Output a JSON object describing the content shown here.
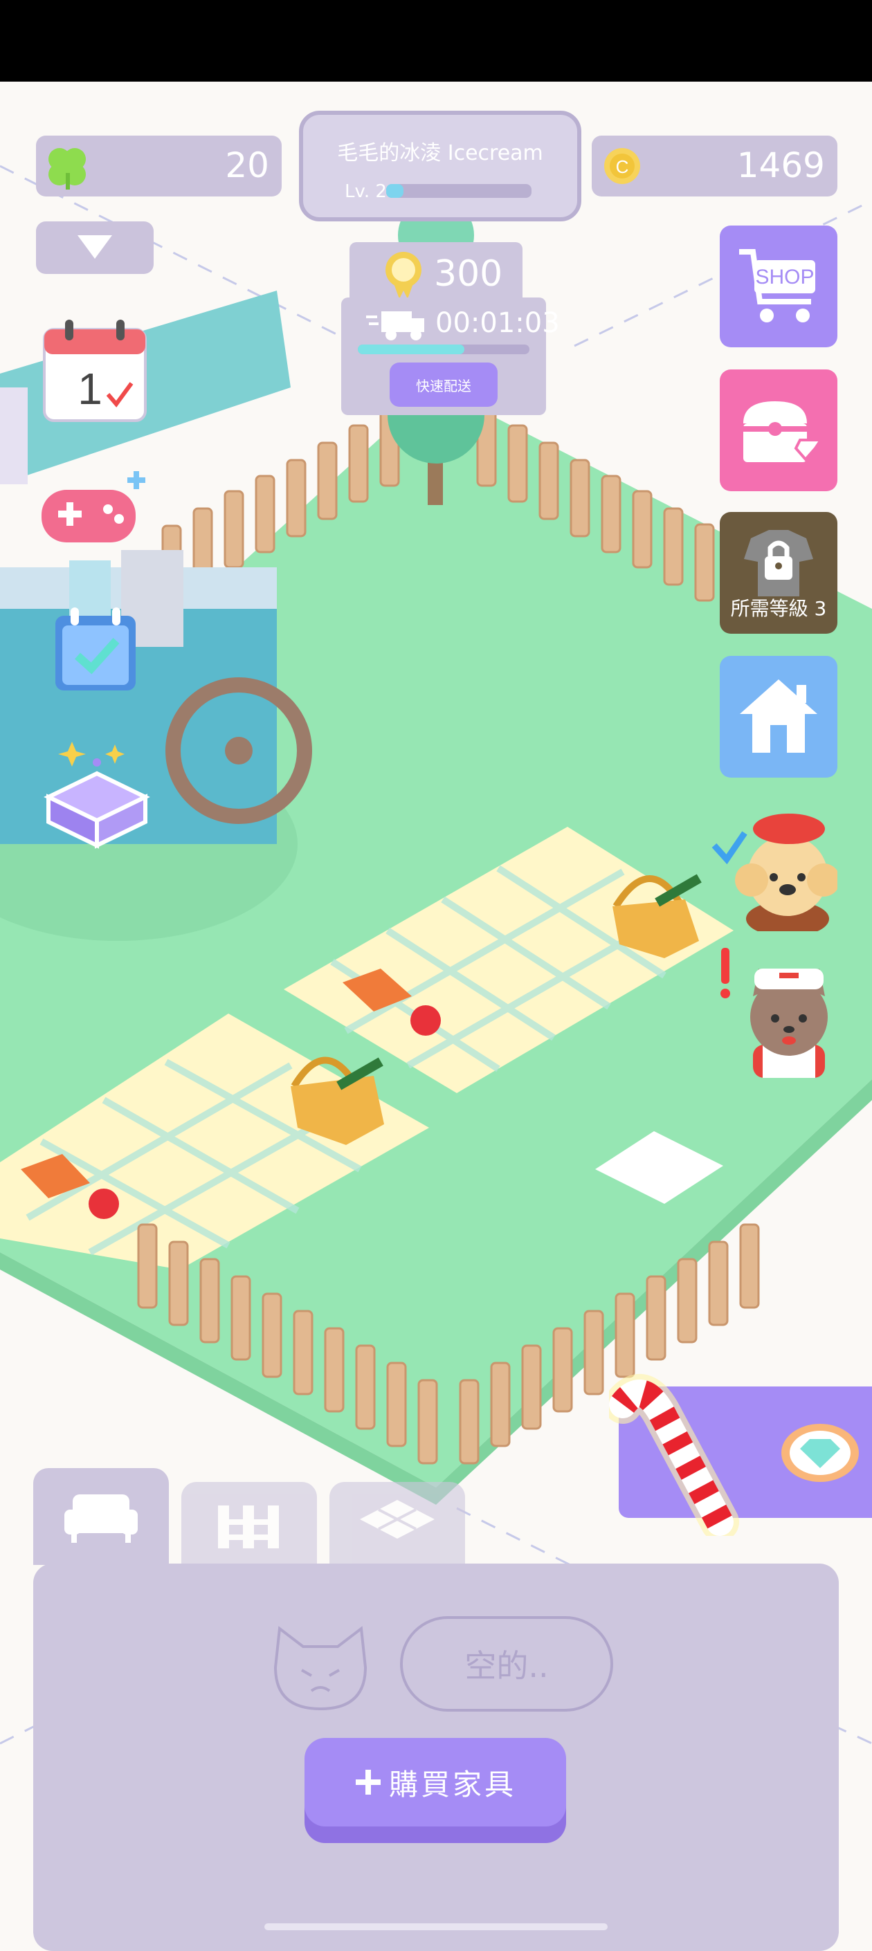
{
  "hud": {
    "clover_count": "20",
    "coins": "1469",
    "shop_name": "毛毛的冰淩 Icecream",
    "level_label": "Lv. 2",
    "level_progress": 0.12
  },
  "delivery": {
    "reward": "300",
    "timer": "00:01:03",
    "progress": 0.62,
    "fast_delivery_label": "快速配送"
  },
  "right_menu": {
    "shop_label": "SHOP",
    "locked_label": "所需等級 3"
  },
  "bottom_panel": {
    "empty_label": "空的..",
    "buy_button_label": "購買家具"
  },
  "icons": {
    "clover": "clover-icon",
    "coin": "coin-icon",
    "calendar_day": "1"
  },
  "colors": {
    "grass": "#96e6b3",
    "panel": "#cdc6de",
    "accent_purple": "#a58cf5",
    "pink": "#f46fb0",
    "home_blue": "#7ab6f5",
    "locked_brown": "#6b5a3e"
  }
}
